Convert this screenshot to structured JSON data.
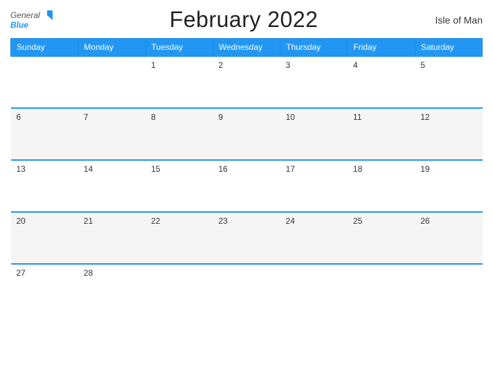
{
  "header": {
    "logo_line1": "General",
    "logo_line2": "Blue",
    "title": "February 2022",
    "country": "Isle of Man"
  },
  "days_of_week": [
    "Sunday",
    "Monday",
    "Tuesday",
    "Wednesday",
    "Thursday",
    "Friday",
    "Saturday"
  ],
  "weeks": [
    [
      null,
      null,
      1,
      2,
      3,
      4,
      5
    ],
    [
      6,
      7,
      8,
      9,
      10,
      11,
      12
    ],
    [
      13,
      14,
      15,
      16,
      17,
      18,
      19
    ],
    [
      20,
      21,
      22,
      23,
      24,
      25,
      26
    ],
    [
      27,
      28,
      null,
      null,
      null,
      null,
      null
    ]
  ]
}
